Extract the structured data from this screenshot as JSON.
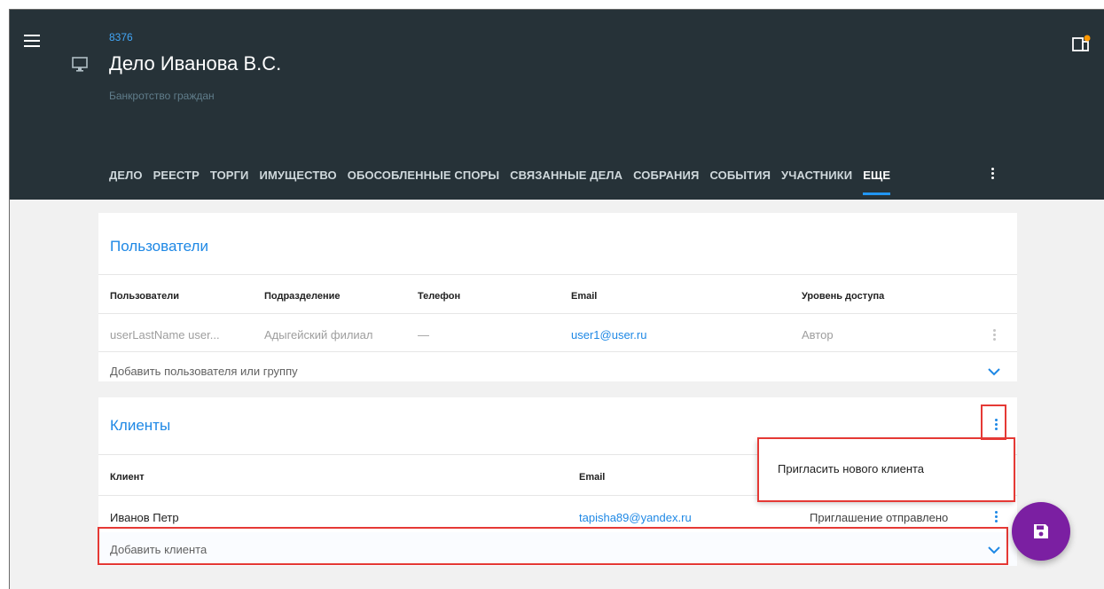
{
  "case": {
    "id": "8376",
    "title": "Дело Иванова В.С.",
    "subtitle": "Банкротство граждан"
  },
  "tabs": [
    {
      "label": "ДЕЛО"
    },
    {
      "label": "РЕЕСТР"
    },
    {
      "label": "ТОРГИ"
    },
    {
      "label": "ИМУЩЕСТВО"
    },
    {
      "label": "ОБОСОБЛЕННЫЕ СПОРЫ"
    },
    {
      "label": "СВЯЗАННЫЕ ДЕЛА"
    },
    {
      "label": "СОБРАНИЯ"
    },
    {
      "label": "СОБЫТИЯ"
    },
    {
      "label": "УЧАСТНИКИ"
    },
    {
      "label": "ЕЩЕ",
      "active": true
    }
  ],
  "users_section": {
    "title": "Пользователи",
    "columns": [
      "Пользователи",
      "Подразделение",
      "Телефон",
      "Email",
      "Уровень доступа"
    ],
    "rows": [
      {
        "user": "userLastName user...",
        "department": "Адыгейский филиал",
        "phone": "—",
        "email": "user1@user.ru",
        "access": "Автор"
      }
    ],
    "add_label": "Добавить пользователя или группу"
  },
  "clients_section": {
    "title": "Клиенты",
    "columns": [
      "Клиент",
      "Email"
    ],
    "rows": [
      {
        "client": "Иванов Петр",
        "email": "tapisha89@yandex.ru",
        "status": "Приглашение отправлено"
      }
    ],
    "add_label": "Добавить клиента",
    "menu": [
      "Пригласить нового клиента"
    ]
  },
  "colors": {
    "header_bg": "#263238",
    "accent": "#1e88e5",
    "fab": "#7b1fa2",
    "highlight": "#e53935"
  },
  "icons": {
    "menu": "hamburger-icon",
    "case": "monitor-icon",
    "top_right": "notification-layout-icon",
    "fab": "save-icon"
  }
}
